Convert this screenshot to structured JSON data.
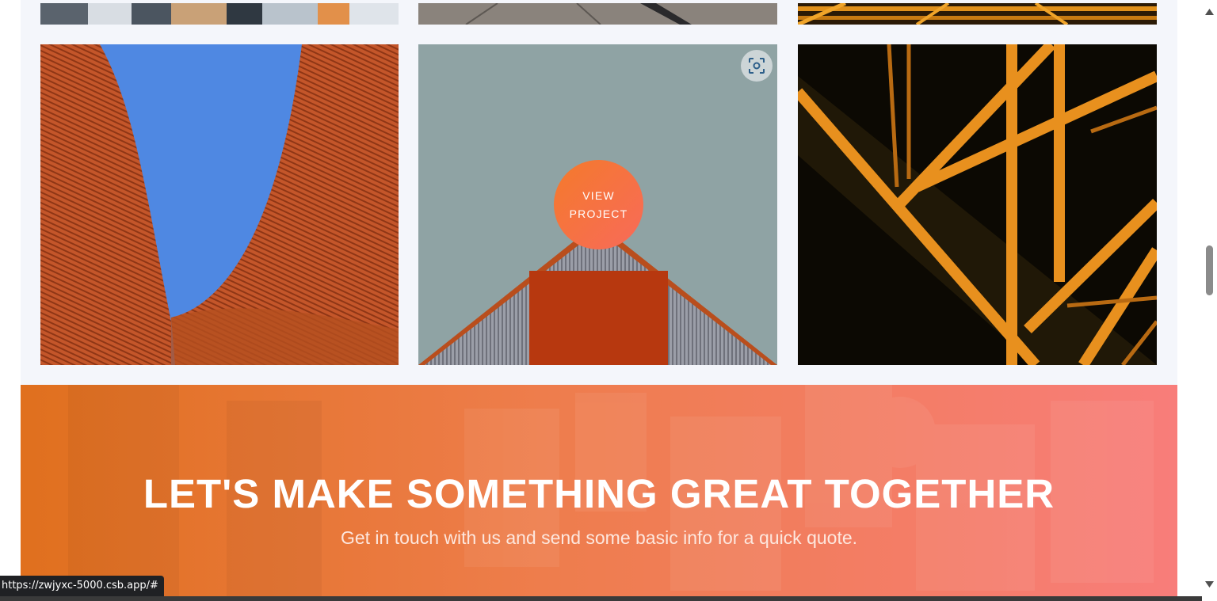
{
  "gallery": {
    "view_button": {
      "line1": "VIEW",
      "line2": "PROJECT"
    },
    "lens_icon": "lens-scan-icon",
    "tiles": [
      {
        "name": "orange-curved-facade"
      },
      {
        "name": "grey-gable-building"
      },
      {
        "name": "orange-steel-truss"
      }
    ]
  },
  "cta": {
    "title": "LET'S MAKE SOMETHING GREAT TOGETHER",
    "subtitle": "Get in touch with us and send some basic info for a quick quote."
  },
  "status_bar": {
    "url": "https://zwjyxc-5000.csb.app/#"
  },
  "colors": {
    "gallery_bg": "#f4f6fb",
    "cta_start": "#e0701e",
    "cta_end": "#f87d7a",
    "button_gradient_start": "#f47a2b",
    "button_gradient_end": "#f86a5a"
  }
}
